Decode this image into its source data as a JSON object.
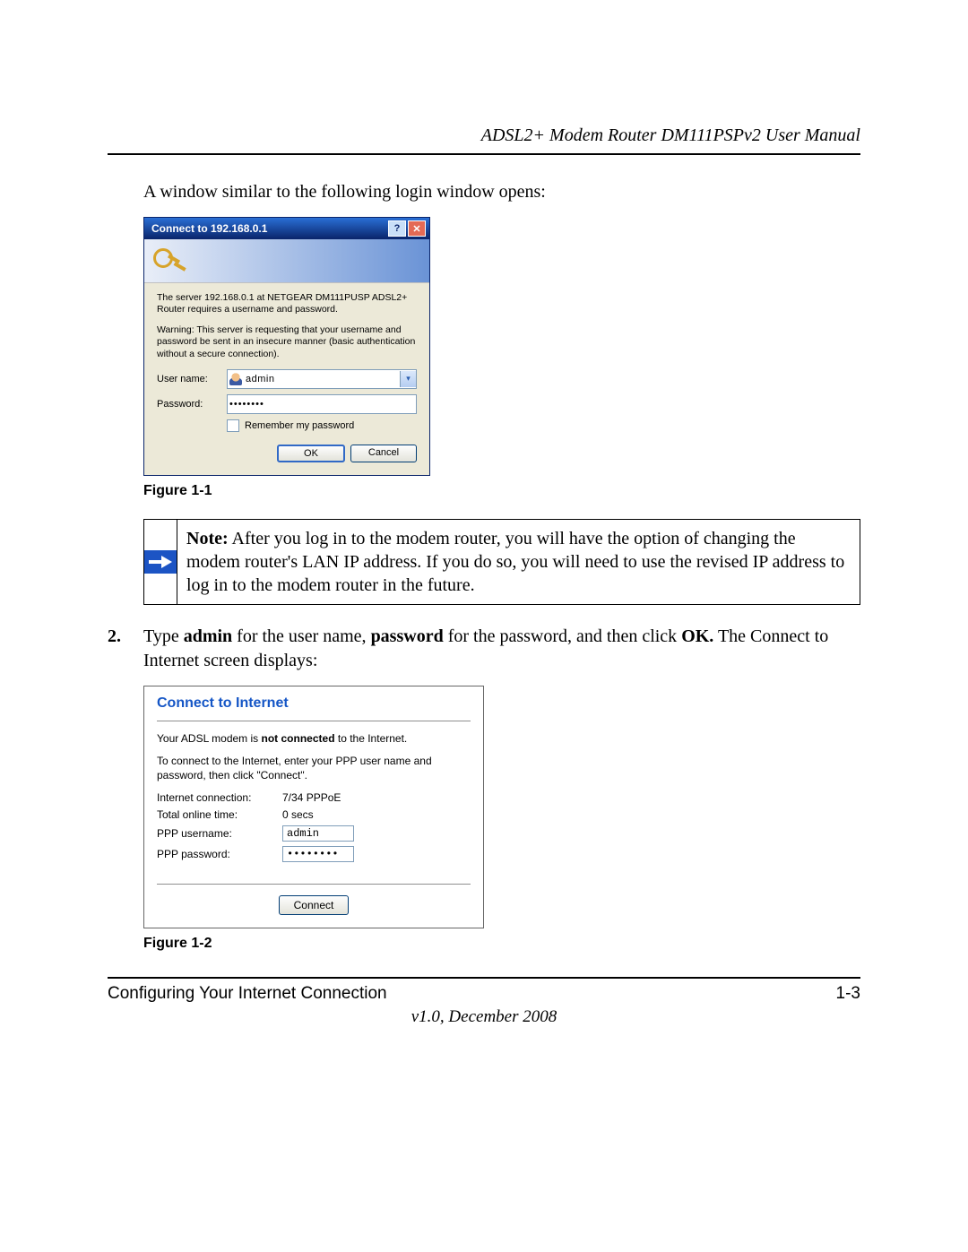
{
  "header": {
    "title": "ADSL2+ Modem Router DM111PSPv2 User Manual"
  },
  "intro_text": "A window similar to the following login window opens:",
  "login_dialog": {
    "title": "Connect to 192.168.0.1",
    "help_glyph": "?",
    "close_glyph": "✕",
    "message1": "The server 192.168.0.1 at NETGEAR DM111PUSP  ADSL2+ Router requires a username and password.",
    "message2": "Warning: This server is requesting that your username and password be sent in an insecure manner (basic authentication without a secure connection).",
    "username_label": "User name:",
    "username_value": "admin",
    "password_label": "Password:",
    "password_value": "••••••••",
    "remember_label": "Remember my password",
    "ok_label": "OK",
    "cancel_label": "Cancel"
  },
  "figure1_caption": "Figure 1-1",
  "note": {
    "prefix": "Note:",
    "text": " After you log in to the modem router, you will have the option of changing the modem router's LAN IP address. If you do so, you will need to use the revised IP address to log in to the modem router in the future."
  },
  "step2": {
    "number": "2.",
    "pre": "Type ",
    "b1": "admin",
    "mid1": " for the user name, ",
    "b2": "password",
    "mid2": " for the password, and then click ",
    "b3": "OK.",
    "post": " The Connect to Internet screen displays:"
  },
  "cti": {
    "title": "Connect to Internet",
    "status_pre": "Your ADSL modem is ",
    "status_bold": "not connected",
    "status_post": " to the Internet.",
    "instruction": "To connect to the Internet, enter your PPP user name and password, then click \"Connect\".",
    "conn_label": "Internet connection:",
    "conn_value": "7/34  PPPoE",
    "online_label": "Total online time:",
    "online_value": "0 secs",
    "ppp_user_label": "PPP username:",
    "ppp_user_value": "admin",
    "ppp_pass_label": "PPP password:",
    "ppp_pass_value": "••••••••",
    "connect_label": "Connect"
  },
  "figure2_caption": "Figure 1-2",
  "footer": {
    "section": "Configuring Your Internet Connection",
    "page": "1-3",
    "version": "v1.0, December 2008"
  }
}
